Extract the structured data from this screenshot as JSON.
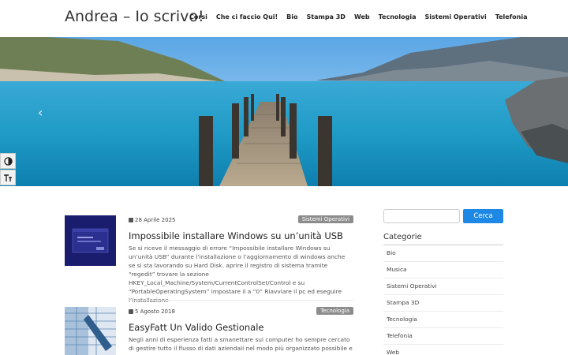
{
  "header": {
    "site_title": "Andrea – Io scrivo!",
    "nav": [
      "Corsi",
      "Che ci faccio Qui!",
      "Bio",
      "Stampa 3D",
      "Web",
      "Tecnologia",
      "Sistemi Operativi",
      "Telefonia"
    ]
  },
  "slider": {
    "prev_label": "‹"
  },
  "accessibility": {
    "contrast_icon": "contrast-icon",
    "font_icon": "font-size-icon"
  },
  "posts": [
    {
      "date": "28 Aprile 2025",
      "category": "Sistemi Operativi",
      "title": "Impossibile installare Windows su un’unità USB",
      "excerpt": "Se si riceve il messaggio di errore “Impossibile installare Windows su un’unità USB” durante l’installazione o l’aggiornamento di windows anche se si sta lavorando su Hard Disk. aprire il registro di sistema tramite “regedit” trovare la sezione HKEY_Local_Machine/System/CurrentControlSet/Control e su “PortableOperatingSystem” impostare il a “0” Riavviare il pc ed eseguire l’installazione"
    },
    {
      "date": "5 Agosto 2018",
      "category": "Tecnologia",
      "title": "EasyFatt Un Valido Gestionale",
      "excerpt": "Negli anni di esperienza fatti a smanettare sui computer ho sempre cercato di gestire tutto il flusso di dati aziendali nel modo più organizzato possibile e sono"
    }
  ],
  "sidebar": {
    "search_placeholder": "",
    "search_button": "Cerca",
    "categories_title": "Categorie",
    "categories": [
      "Bio",
      "Musica",
      "Sistemi Operativi",
      "Stampa 3D",
      "Tecnologia",
      "Telefonia",
      "Web"
    ]
  },
  "colors": {
    "accent": "#1e88e5",
    "badge": "#8c8c8c"
  }
}
